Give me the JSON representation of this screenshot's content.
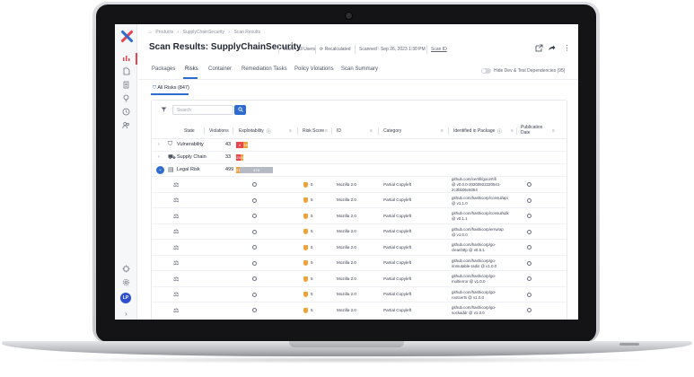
{
  "breadcrumb": {
    "items": [
      "Products",
      "SupplyChainSecurity",
      "Scan Results"
    ],
    "separator": "›"
  },
  "page_title": "Scan Results: SupplyChainSecurity",
  "meta": {
    "team": "Team : All Users",
    "recalculated": "Recalculated",
    "scanned": "Scanned : Sep 26, 2023 1:30 PM",
    "scan_id": "Scan ID"
  },
  "tabs": [
    "Packages",
    "Risks",
    "Container",
    "Remediation Tasks",
    "Policy Violations",
    "Scan Summary"
  ],
  "active_tab": "Risks",
  "toggle_label": "Hide Dev & Test Dependencies (95)",
  "subtab": "All Risks (847)",
  "search": {
    "placeholder": "Search"
  },
  "columns": [
    "State",
    "Violations",
    "Exploitability",
    "Risk Score",
    "ID",
    "Category",
    "Identified in Package",
    "Publication Date"
  ],
  "groups": [
    {
      "label": "Vulnerability",
      "count": "43",
      "icon": "shield-outline-icon",
      "segments": [
        {
          "label": "4",
          "color": "#e8434e",
          "fraction": 0.12
        },
        {
          "label": "19",
          "color": "#f0a23a",
          "fraction": 0.08
        }
      ]
    },
    {
      "label": "Supply Chain",
      "count": "33",
      "icon": "truck-icon",
      "segments": [
        {
          "label": "25",
          "color": "#e8434e",
          "fraction": 0.08
        },
        {
          "label": "8",
          "color": "#f0a23a",
          "fraction": 0.04
        }
      ]
    },
    {
      "label": "Legal Risk",
      "count": "499",
      "icon": "document-icon",
      "segments": [
        {
          "label": "21",
          "color": "#f0a23a",
          "fraction": 0.06
        },
        {
          "label": "478",
          "color": "#b6bac2",
          "fraction": 0.58
        }
      ]
    }
  ],
  "rows": [
    {
      "score": "5",
      "id": "Mozilla 2.0",
      "category": "Partial Copyleft",
      "package": [
        "github.com/certifi/gocertifi",
        "@ v0.0.0-20200922220541-",
        "2c3bb06c6054"
      ]
    },
    {
      "score": "5",
      "id": "Mozilla 2.0",
      "category": "Partial Copyleft",
      "package": [
        "github.com/hashicorp/consul/api",
        "@ v1.1.0"
      ]
    },
    {
      "score": "5",
      "id": "Mozilla 2.0",
      "category": "Partial Copyleft",
      "package": [
        "github.com/hashicorp/consul/sdk",
        "@ v0.1.1"
      ]
    },
    {
      "score": "5",
      "id": "Mozilla 2.0",
      "category": "Partial Copyleft",
      "package": [
        "github.com/hashicorp/errwrap",
        "@ v1.0.0"
      ]
    },
    {
      "score": "5",
      "id": "Mozilla 2.0",
      "category": "Partial Copyleft",
      "package": [
        "github.com/hashicorp/go-",
        "cleanhttp @ v0.5.1"
      ]
    },
    {
      "score": "5",
      "id": "Mozilla 2.0",
      "category": "Partial Copyleft",
      "package": [
        "github.com/hashicorp/go-",
        "immutable-radix @ v1.0.0"
      ]
    },
    {
      "score": "5",
      "id": "Mozilla 2.0",
      "category": "Partial Copyleft",
      "package": [
        "github.com/hashicorp/go-",
        "multierror @ v1.0.0"
      ]
    },
    {
      "score": "5",
      "id": "Mozilla 2.0",
      "category": "Partial Copyleft",
      "package": [
        "github.com/hashicorp/go-",
        "rootcerts @ v1.0.0"
      ]
    },
    {
      "score": "5",
      "id": "Mozilla 2.0",
      "category": "Partial Copyleft",
      "package": [
        "github.com/hashicorp/go-",
        "sockaddr @ v1.0.0"
      ]
    }
  ],
  "sidebar": {
    "icons": [
      "chart-icon",
      "file-icon",
      "list-icon",
      "bulb-icon",
      "clock-icon",
      "users-icon",
      "plugin-icon",
      "settings-icon"
    ],
    "avatar": "LP",
    "expand": "›"
  },
  "colors": {
    "accent": "#2f6cd0",
    "brand_red": "#e8434e",
    "warning": "#f0a23a"
  }
}
